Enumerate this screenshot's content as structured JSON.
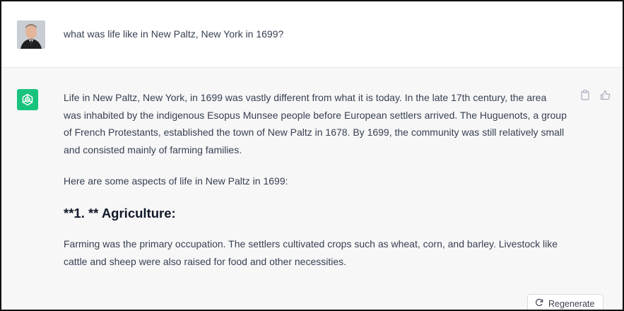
{
  "user_message": {
    "avatar": "user-photo-avatar",
    "text": "what was life like in New Paltz, New York in 1699?"
  },
  "assistant_message": {
    "avatar": "openai-logo-icon",
    "paragraph_1": "Life in New Paltz, New York, in 1699 was vastly different from what it is today. In the late 17th century, the area was inhabited by the indigenous Esopus Munsee people before European settlers arrived. The Huguenots, a group of French Protestants, established the town of New Paltz in 1678. By 1699, the community was still relatively small and consisted mainly of farming families.",
    "paragraph_2": "Here are some aspects of life in New Paltz in 1699:",
    "heading_1": "**1. ** Agriculture:",
    "paragraph_3": "Farming was the primary occupation. The settlers cultivated crops such as wheat, corn, and barley. Livestock like cattle and sheep were also raised for food and other necessities."
  },
  "actions": {
    "copy_icon": "clipboard-icon",
    "like_icon": "thumbs-up-icon"
  },
  "regenerate": {
    "icon": "refresh-icon",
    "label": "Regenerate"
  },
  "colors": {
    "assistant_bg": "#f7f7f8",
    "bot_avatar": "#19c37d",
    "text": "#374151"
  }
}
